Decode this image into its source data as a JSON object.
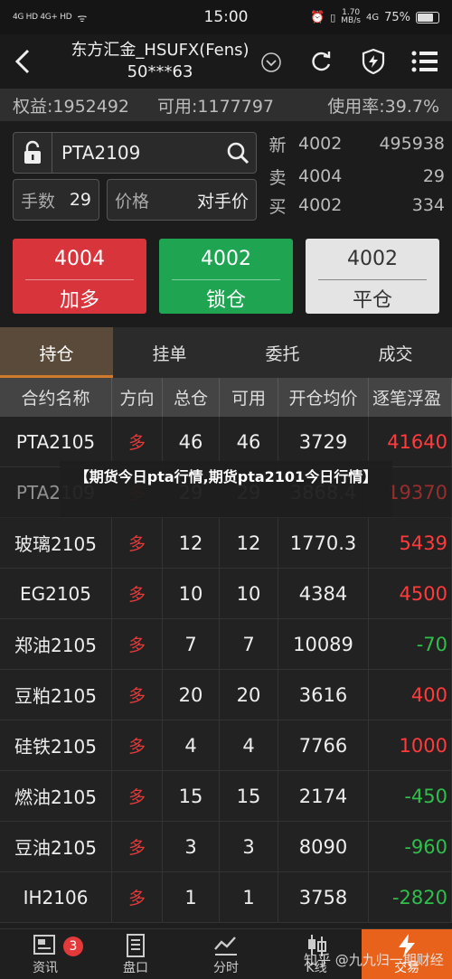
{
  "status_bar": {
    "signal_left": "4G HD 4G+ HD",
    "time": "15:00",
    "speed": "1.70",
    "speed_unit": "MB/s",
    "network": "4G",
    "battery": "75%",
    "battery_level": 0.75
  },
  "header": {
    "title_line1": "东方汇金_HSUFX(Fens)",
    "title_line2": "50***63"
  },
  "account": {
    "equity": "权益:1952492",
    "available": "可用:1177797",
    "usage": "使用率:39.7%"
  },
  "order": {
    "contract": "PTA2109",
    "qty_label": "手数",
    "qty_value": "29",
    "price_label": "价格",
    "price_value": "对手价"
  },
  "quotes": [
    {
      "label": "新",
      "price": "4002",
      "volume": "495938"
    },
    {
      "label": "卖",
      "price": "4004",
      "volume": "29"
    },
    {
      "label": "买",
      "price": "4002",
      "volume": "334"
    }
  ],
  "trade_buttons": {
    "buy_price": "4004",
    "buy_label": "加多",
    "lock_price": "4002",
    "lock_label": "锁仓",
    "close_price": "4002",
    "close_label": "平仓"
  },
  "tabs": [
    "持仓",
    "挂单",
    "委托",
    "成交"
  ],
  "table": {
    "headers": [
      "合约名称",
      "方向",
      "总仓",
      "可用",
      "开仓均价",
      "逐笔浮盈"
    ],
    "rows": [
      {
        "name": "PTA2105",
        "dir": "多",
        "total": "46",
        "avail": "46",
        "avg": "3729",
        "pnl": "41640"
      },
      {
        "name": "PTA2109",
        "dir": "多",
        "total": "29",
        "avail": "29",
        "avg": "3868.4",
        "pnl": "19370"
      },
      {
        "name": "玻璃2105",
        "dir": "多",
        "total": "12",
        "avail": "12",
        "avg": "1770.3",
        "pnl": "5439"
      },
      {
        "name": "EG2105",
        "dir": "多",
        "total": "10",
        "avail": "10",
        "avg": "4384",
        "pnl": "4500"
      },
      {
        "name": "郑油2105",
        "dir": "多",
        "total": "7",
        "avail": "7",
        "avg": "10089",
        "pnl": "-70"
      },
      {
        "name": "豆粕2105",
        "dir": "多",
        "total": "20",
        "avail": "20",
        "avg": "3616",
        "pnl": "400"
      },
      {
        "name": "硅铁2105",
        "dir": "多",
        "total": "4",
        "avail": "4",
        "avg": "7766",
        "pnl": "1000"
      },
      {
        "name": "燃油2105",
        "dir": "多",
        "total": "15",
        "avail": "15",
        "avg": "2174",
        "pnl": "-450"
      },
      {
        "name": "豆油2105",
        "dir": "多",
        "total": "3",
        "avail": "3",
        "avg": "8090",
        "pnl": "-960"
      },
      {
        "name": "IH2106",
        "dir": "多",
        "total": "1",
        "avail": "1",
        "avg": "3758",
        "pnl": "-2820"
      }
    ]
  },
  "caption": "【期货今日pta行情,期货pta2101今日行情】",
  "bottom_nav": {
    "items": [
      "资讯",
      "盘口",
      "分时",
      "K线",
      "交易"
    ],
    "badge": "3"
  },
  "watermark": "知乎 @九九归一期财经",
  "colors": {
    "buy": "#d7343c",
    "lock": "#1fa552",
    "active_tab": "#d07a2c",
    "trade_nav": "#e8621c"
  }
}
